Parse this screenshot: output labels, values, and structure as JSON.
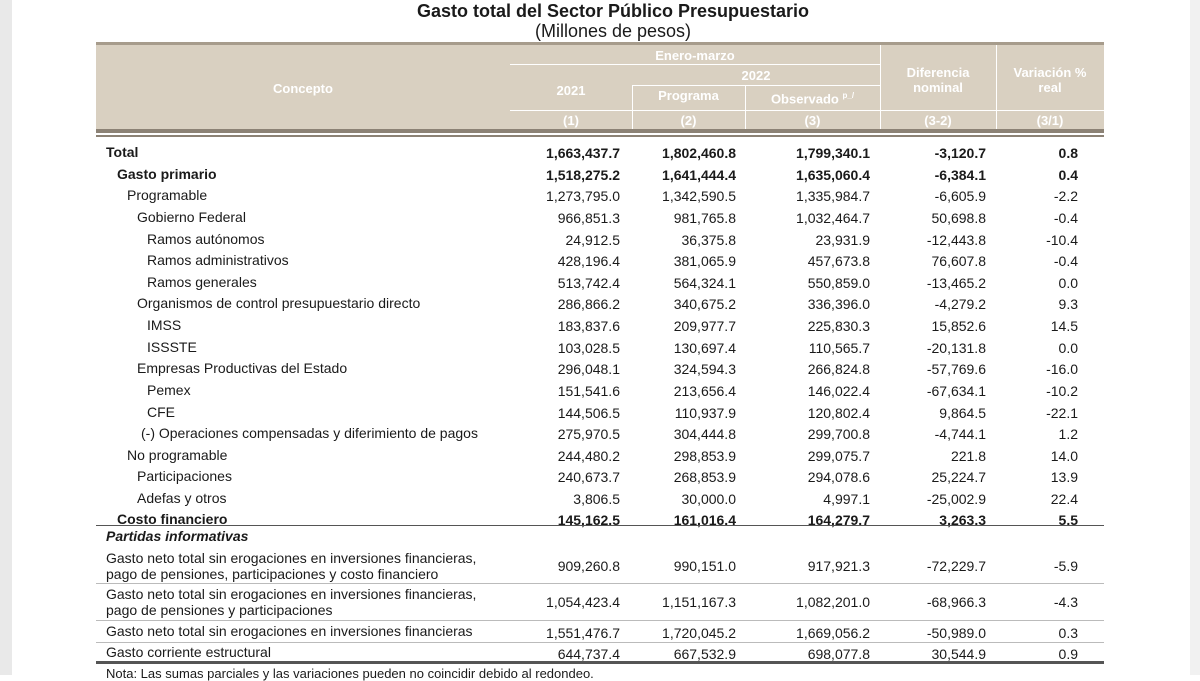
{
  "title": "Gasto total del Sector Público Presupuestario",
  "subtitle": "(Millones de pesos)",
  "header": {
    "concepto": "Concepto",
    "enero_marzo": "Enero-marzo",
    "year_2021": "2021",
    "year_2022": "2022",
    "programa": "Programa",
    "observado": "Observado",
    "observado_sup": "p_/",
    "diferencia": "Diferencia nominal",
    "variacion": "Variación % real",
    "col1": "(1)",
    "col2": "(2)",
    "col3": "(3)",
    "col32": "(3-2)",
    "col31": "(3/1)"
  },
  "rows": [
    {
      "concept": "Total",
      "v2021": "1,663,437.7",
      "programa": "1,802,460.8",
      "observado": "1,799,340.1",
      "diferencia": "-3,120.7",
      "variacion": "0.8"
    },
    {
      "concept": "Gasto primario",
      "v2021": "1,518,275.2",
      "programa": "1,641,444.4",
      "observado": "1,635,060.4",
      "diferencia": "-6,384.1",
      "variacion": "0.4"
    },
    {
      "concept": "Programable",
      "v2021": "1,273,795.0",
      "programa": "1,342,590.5",
      "observado": "1,335,984.7",
      "diferencia": "-6,605.9",
      "variacion": "-2.2"
    },
    {
      "concept": "Gobierno Federal",
      "v2021": "966,851.3",
      "programa": "981,765.8",
      "observado": "1,032,464.7",
      "diferencia": "50,698.8",
      "variacion": "-0.4"
    },
    {
      "concept": "Ramos autónomos",
      "v2021": "24,912.5",
      "programa": "36,375.8",
      "observado": "23,931.9",
      "diferencia": "-12,443.8",
      "variacion": "-10.4"
    },
    {
      "concept": "Ramos administrativos",
      "v2021": "428,196.4",
      "programa": "381,065.9",
      "observado": "457,673.8",
      "diferencia": "76,607.8",
      "variacion": "-0.4"
    },
    {
      "concept": "Ramos generales",
      "v2021": "513,742.4",
      "programa": "564,324.1",
      "observado": "550,859.0",
      "diferencia": "-13,465.2",
      "variacion": "0.0"
    },
    {
      "concept": "Organismos de control presupuestario directo",
      "v2021": "286,866.2",
      "programa": "340,675.2",
      "observado": "336,396.0",
      "diferencia": "-4,279.2",
      "variacion": "9.3"
    },
    {
      "concept": "IMSS",
      "v2021": "183,837.6",
      "programa": "209,977.7",
      "observado": "225,830.3",
      "diferencia": "15,852.6",
      "variacion": "14.5"
    },
    {
      "concept": "ISSSTE",
      "v2021": "103,028.5",
      "programa": "130,697.4",
      "observado": "110,565.7",
      "diferencia": "-20,131.8",
      "variacion": "0.0"
    },
    {
      "concept": "Empresas Productivas del Estado",
      "v2021": "296,048.1",
      "programa": "324,594.3",
      "observado": "266,824.8",
      "diferencia": "-57,769.6",
      "variacion": "-16.0"
    },
    {
      "concept": "Pemex",
      "v2021": "151,541.6",
      "programa": "213,656.4",
      "observado": "146,022.4",
      "diferencia": "-67,634.1",
      "variacion": "-10.2"
    },
    {
      "concept": "CFE",
      "v2021": "144,506.5",
      "programa": "110,937.9",
      "observado": "120,802.4",
      "diferencia": "9,864.5",
      "variacion": "-22.1"
    },
    {
      "concept": "(-) Operaciones compensadas y diferimiento de pagos",
      "v2021": "275,970.5",
      "programa": "304,444.8",
      "observado": "299,700.8",
      "diferencia": "-4,744.1",
      "variacion": "1.2"
    },
    {
      "concept": "No programable",
      "v2021": "244,480.2",
      "programa": "298,853.9",
      "observado": "299,075.7",
      "diferencia": "221.8",
      "variacion": "14.0"
    },
    {
      "concept": "Participaciones",
      "v2021": "240,673.7",
      "programa": "268,853.9",
      "observado": "294,078.6",
      "diferencia": "25,224.7",
      "variacion": "13.9"
    },
    {
      "concept": "Adefas y otros",
      "v2021": "3,806.5",
      "programa": "30,000.0",
      "observado": "4,997.1",
      "diferencia": "-25,002.9",
      "variacion": "22.4"
    },
    {
      "concept": "Costo financiero",
      "v2021": "145,162.5",
      "programa": "161,016.4",
      "observado": "164,279.7",
      "diferencia": "3,263.3",
      "variacion": "5.5"
    }
  ],
  "partidas_title": "Partidas informativas",
  "partidas": [
    {
      "line1": "Gasto neto total sin erogaciones en inversiones financieras,",
      "line2": "pago de pensiones, participaciones y costo financiero",
      "v2021": "909,260.8",
      "programa": "990,151.0",
      "observado": "917,921.3",
      "diferencia": "-72,229.7",
      "variacion": "-5.9"
    },
    {
      "line1": "Gasto neto total sin erogaciones en inversiones financieras,",
      "line2": "pago de pensiones y participaciones",
      "v2021": "1,054,423.4",
      "programa": "1,151,167.3",
      "observado": "1,082,201.0",
      "diferencia": "-68,966.3",
      "variacion": "-4.3"
    },
    {
      "line1": "Gasto neto total sin erogaciones en inversiones financieras",
      "line2": "",
      "v2021": "1,551,476.7",
      "programa": "1,720,045.2",
      "observado": "1,669,056.2",
      "diferencia": "-50,989.0",
      "variacion": "0.3"
    },
    {
      "line1": "Gasto corriente estructural",
      "line2": "",
      "v2021": "644,737.4",
      "programa": "667,532.9",
      "observado": "698,077.8",
      "diferencia": "30,544.9",
      "variacion": "0.9"
    }
  ],
  "note": "Nota: Las sumas parciales y las variaciones pueden no coincidir debido al redondeo."
}
